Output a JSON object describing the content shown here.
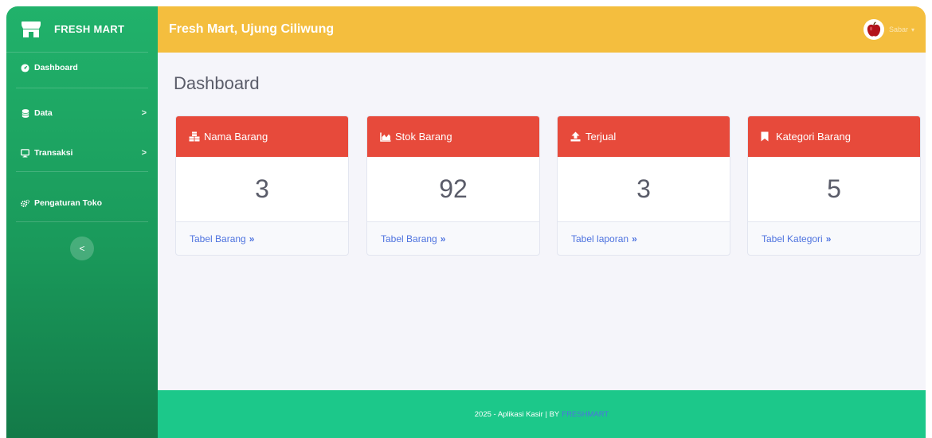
{
  "sidebar": {
    "brand": "FRESH MART",
    "items": [
      {
        "label": "Dashboard",
        "icon": "tachometer-icon"
      },
      {
        "label": "Data",
        "icon": "database-icon",
        "chevron": ">"
      },
      {
        "label": "Transaksi",
        "icon": "desktop-icon",
        "chevron": ">"
      },
      {
        "label": "Pengaturan Toko",
        "icon": "cogs-icon"
      }
    ],
    "toggle": "<"
  },
  "topbar": {
    "title": "Fresh Mart, Ujung Ciliwung",
    "user": "Sabar"
  },
  "main": {
    "title": "Dashboard",
    "cards": [
      {
        "title": "Nama Barang",
        "icon": "cubes-icon",
        "value": "3",
        "link": "Tabel Barang"
      },
      {
        "title": "Stok Barang",
        "icon": "chart-area-icon",
        "value": "92",
        "link": "Tabel Barang"
      },
      {
        "title": "Terjual",
        "icon": "upload-icon",
        "value": "3",
        "link": "Tabel laporan"
      },
      {
        "title": "Kategori Barang",
        "icon": "bookmark-icon",
        "value": "5",
        "link": "Tabel Kategori"
      }
    ],
    "link_arrows": "»"
  },
  "footer": {
    "text": "2025 - Aplikasi Kasir | BY",
    "brand": "FRESHMART"
  },
  "colors": {
    "sidebar_top": "#21b26b",
    "topbar": "#f4be3e",
    "card_header": "#e74a3b",
    "footer": "#1cc88a",
    "link": "#4e73df"
  }
}
